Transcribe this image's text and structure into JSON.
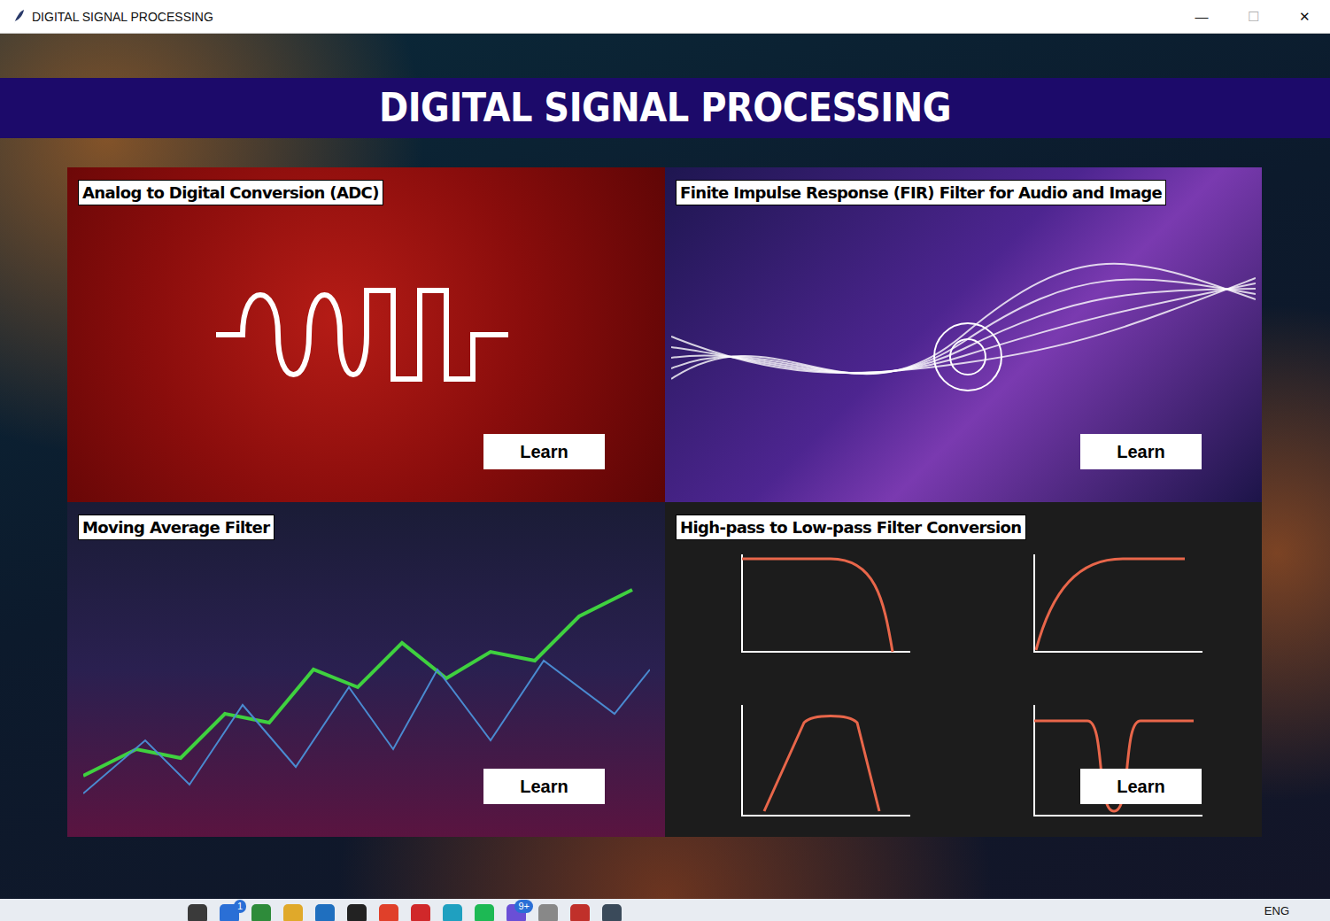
{
  "window": {
    "title": "DIGITAL SIGNAL PROCESSING",
    "controls": [
      "—",
      "☐",
      "✕"
    ]
  },
  "header": {
    "title": "DIGITAL SIGNAL PROCESSING"
  },
  "cards": [
    {
      "title": "Analog to Digital Conversion (ADC)",
      "button": "Learn",
      "kind": "adc"
    },
    {
      "title": "Finite Impulse Response (FIR) Filter for Audio and Image",
      "button": "Learn",
      "kind": "fir"
    },
    {
      "title": "Moving Average Filter",
      "button": "Learn",
      "kind": "ma"
    },
    {
      "title": "High-pass to Low-pass Filter Conversion",
      "button": "Learn",
      "kind": "hp"
    }
  ],
  "taskbar": {
    "items": [
      {
        "color": "#3a3a3a",
        "badge": ""
      },
      {
        "color": "#2a6fd6",
        "badge": "1"
      },
      {
        "color": "#2e8b3a",
        "badge": ""
      },
      {
        "color": "#e0a92a",
        "badge": ""
      },
      {
        "color": "#1f6fbf",
        "badge": ""
      },
      {
        "color": "#222222",
        "badge": ""
      },
      {
        "color": "#e0402a",
        "badge": ""
      },
      {
        "color": "#d0282a",
        "badge": ""
      },
      {
        "color": "#1fa0c0",
        "badge": ""
      },
      {
        "color": "#1db954",
        "badge": ""
      },
      {
        "color": "#6a4fd6",
        "badge": "9+"
      },
      {
        "color": "#888888",
        "badge": ""
      },
      {
        "color": "#c0302a",
        "badge": ""
      },
      {
        "color": "#3a4a5a",
        "badge": ""
      }
    ],
    "language": "ENG"
  }
}
